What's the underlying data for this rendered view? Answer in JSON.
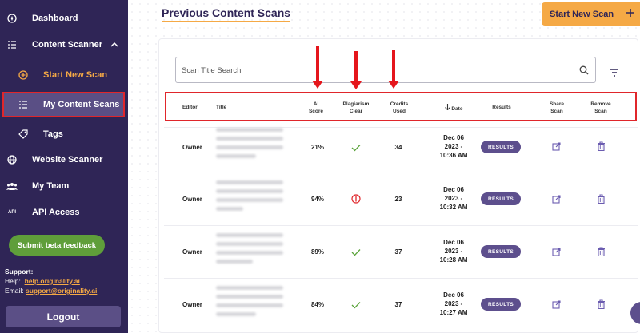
{
  "sidebar": {
    "items": [
      {
        "label": "Dashboard",
        "icon": "compass-icon"
      },
      {
        "label": "Content Scanner",
        "icon": "list-icon"
      },
      {
        "label": "Start New Scan",
        "icon": "plus-circle-icon"
      },
      {
        "label": "My Content Scans",
        "icon": "list-icon"
      },
      {
        "label": "Tags",
        "icon": "tag-icon"
      },
      {
        "label": "Website Scanner",
        "icon": "globe-icon"
      },
      {
        "label": "My Team",
        "icon": "team-icon"
      },
      {
        "label": "API Access",
        "icon": "api-icon"
      }
    ],
    "api_icon_text": "API",
    "beta_label": "Submit beta feedback",
    "support": {
      "heading": "Support:",
      "help_label": "Help:",
      "help_link": "help.originality.ai",
      "email_label": "Email:",
      "email_link": "support@originality.ai"
    },
    "logout_label": "Logout"
  },
  "header": {
    "title": "Previous Content Scans",
    "start_button": "Start New Scan"
  },
  "search": {
    "placeholder": "Scan Title Search"
  },
  "table": {
    "columns": {
      "editor": "Editor",
      "title": "Title",
      "ai_score": [
        "AI",
        "Score"
      ],
      "plagiarism": [
        "Plagiarism",
        "Clear"
      ],
      "credits": [
        "Credits",
        "Used"
      ],
      "date": "Date",
      "results": "Results",
      "share": [
        "Share",
        "Scan"
      ],
      "remove": [
        "Remove",
        "Scan"
      ]
    },
    "rows": [
      {
        "editor": "Owner",
        "ai_score": "21%",
        "plagiarism": "clear",
        "credits": "34",
        "date": [
          "Dec 06",
          "2023 -",
          "10:36 AM"
        ],
        "results": "RESULTS"
      },
      {
        "editor": "Owner",
        "ai_score": "94%",
        "plagiarism": "flagged",
        "credits": "23",
        "date": [
          "Dec 06",
          "2023 -",
          "10:32 AM"
        ],
        "results": "RESULTS"
      },
      {
        "editor": "Owner",
        "ai_score": "89%",
        "plagiarism": "clear",
        "credits": "37",
        "date": [
          "Dec 06",
          "2023 -",
          "10:28 AM"
        ],
        "results": "RESULTS"
      },
      {
        "editor": "Owner",
        "ai_score": "84%",
        "plagiarism": "clear",
        "credits": "37",
        "date": [
          "Dec 06",
          "2023 -",
          "10:27 AM"
        ],
        "results": "RESULTS"
      }
    ]
  },
  "colors": {
    "sidebar_bg": "#2f2556",
    "accent": "#f5a945",
    "primary": "#5d4f8d",
    "check": "#5aa33a",
    "alert": "#e0262b"
  }
}
